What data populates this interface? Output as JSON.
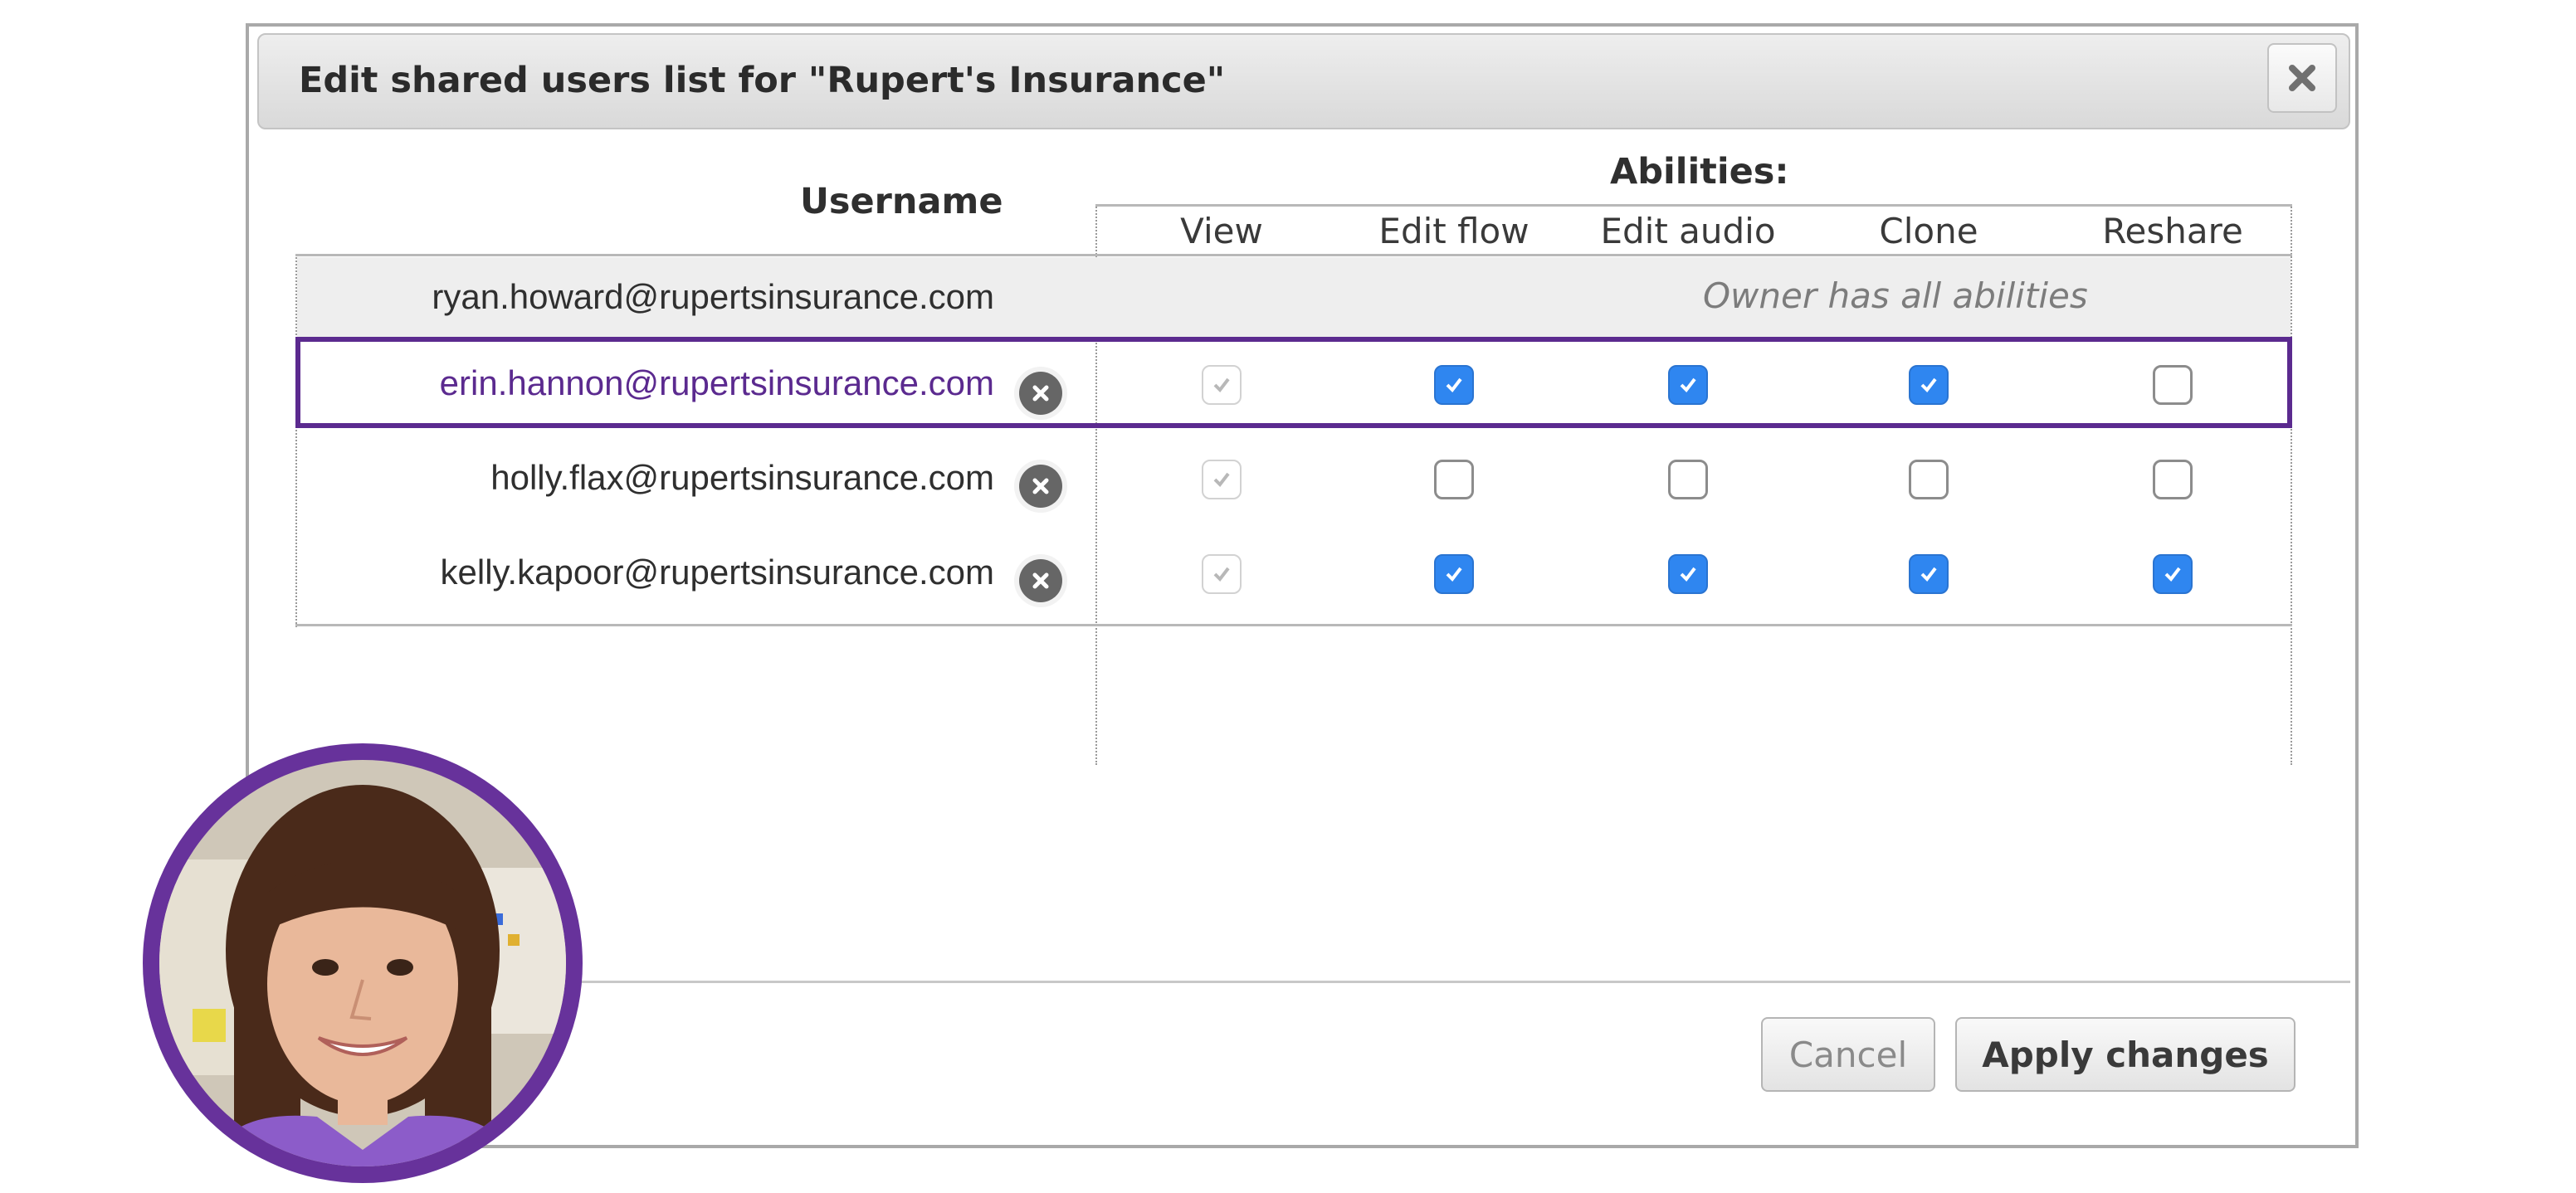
{
  "dialog": {
    "title": "Edit shared users list for \"Rupert's Insurance\"",
    "close_icon": "close-icon"
  },
  "table": {
    "username_header": "Username",
    "abilities_header": "Abilities:",
    "columns": [
      "View",
      "Edit flow",
      "Edit audio",
      "Clone",
      "Reshare"
    ],
    "owner": {
      "username": "ryan.howard@rupertsinsurance.com",
      "note": "Owner has all abilities"
    },
    "users": [
      {
        "username": "erin.hannon@rupertsinsurance.com",
        "highlighted": true,
        "view": true,
        "edit_flow": true,
        "edit_audio": true,
        "clone": true,
        "reshare": false
      },
      {
        "username": "holly.flax@rupertsinsurance.com",
        "highlighted": false,
        "view": true,
        "edit_flow": false,
        "edit_audio": false,
        "clone": false,
        "reshare": false
      },
      {
        "username": "kelly.kapoor@rupertsinsurance.com",
        "highlighted": false,
        "view": true,
        "edit_flow": true,
        "edit_audio": true,
        "clone": true,
        "reshare": true
      }
    ],
    "remove_icon": "remove-user-icon"
  },
  "buttons": {
    "cancel": "Cancel",
    "apply": "Apply changes"
  },
  "colors": {
    "highlight": "#5b2a8f",
    "checkbox_checked": "#2f86f0",
    "avatar_ring": "#67329b"
  }
}
